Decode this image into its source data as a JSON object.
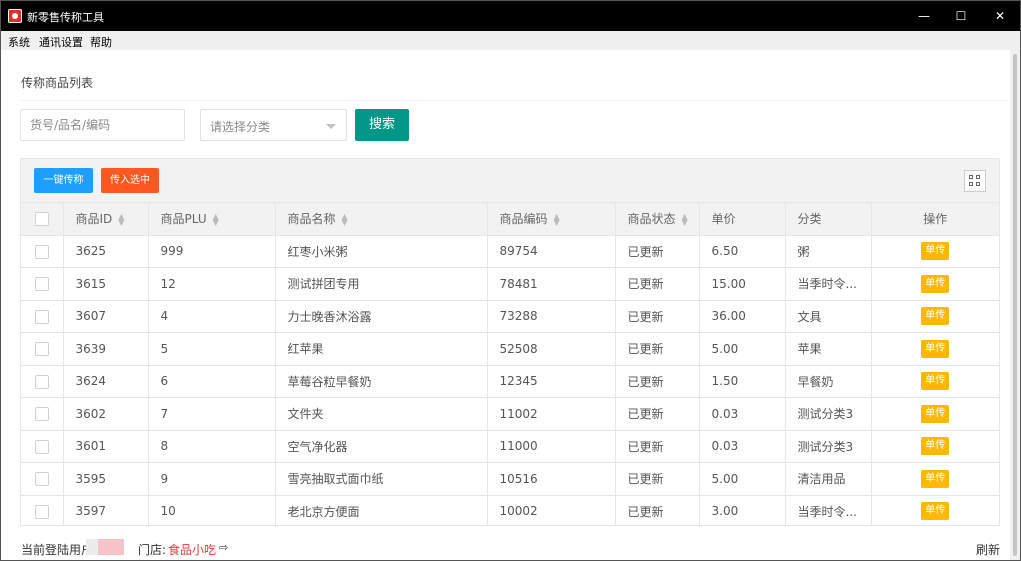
{
  "window": {
    "title": "新零售传称工具",
    "minimize": "—",
    "maximize": "☐",
    "close": "✕"
  },
  "menu": [
    "系统",
    "通讯设置",
    "帮助"
  ],
  "page": {
    "title": "传称商品列表"
  },
  "search": {
    "placeholder": "货号/品名/编码",
    "value": "",
    "category_placeholder": "请选择分类",
    "button": "搜索"
  },
  "toolbar": {
    "send_all": "一键传称",
    "send_selected": "传入选中",
    "layout_icon": "grid-icon"
  },
  "table": {
    "columns": [
      "",
      "商品ID",
      "商品PLU",
      "商品名称",
      "商品编码",
      "商品状态",
      "单价",
      "分类",
      "操作"
    ],
    "action_label": "单传",
    "rows": [
      {
        "id": "3625",
        "plu": "999",
        "name": "红枣小米粥",
        "code": "89754",
        "status": "已更新",
        "price": "6.50",
        "category": "粥"
      },
      {
        "id": "3615",
        "plu": "12",
        "name": "测试拼团专用",
        "code": "78481",
        "status": "已更新",
        "price": "15.00",
        "category": "当季时令..."
      },
      {
        "id": "3607",
        "plu": "4",
        "name": "力士晚香沐浴露",
        "code": "73288",
        "status": "已更新",
        "price": "36.00",
        "category": "文具"
      },
      {
        "id": "3639",
        "plu": "5",
        "name": "红苹果",
        "code": "52508",
        "status": "已更新",
        "price": "5.00",
        "category": "苹果"
      },
      {
        "id": "3624",
        "plu": "6",
        "name": "草莓谷粒早餐奶",
        "code": "12345",
        "status": "已更新",
        "price": "1.50",
        "category": "早餐奶"
      },
      {
        "id": "3602",
        "plu": "7",
        "name": "文件夹",
        "code": "11002",
        "status": "已更新",
        "price": "0.03",
        "category": "测试分类3"
      },
      {
        "id": "3601",
        "plu": "8",
        "name": "空气净化器",
        "code": "11000",
        "status": "已更新",
        "price": "0.03",
        "category": "测试分类3"
      },
      {
        "id": "3595",
        "plu": "9",
        "name": "雪亮抽取式面巾纸",
        "code": "10516",
        "status": "已更新",
        "price": "5.00",
        "category": "清洁用品"
      },
      {
        "id": "3597",
        "plu": "10",
        "name": "老北京方便面",
        "code": "10002",
        "status": "已更新",
        "price": "3.00",
        "category": "当季时令..."
      }
    ]
  },
  "status": {
    "login_label": "当前登陆用户",
    "store_label": "门店:",
    "store_name": "食品小吃",
    "logout_icon": "logout-icon",
    "refresh": "刷新"
  },
  "colors": {
    "search_button": "#009688",
    "send_all": "#1e9fff",
    "send_selected": "#ff5722",
    "single_send": "#ffb800",
    "store_name": "#e4393c"
  }
}
